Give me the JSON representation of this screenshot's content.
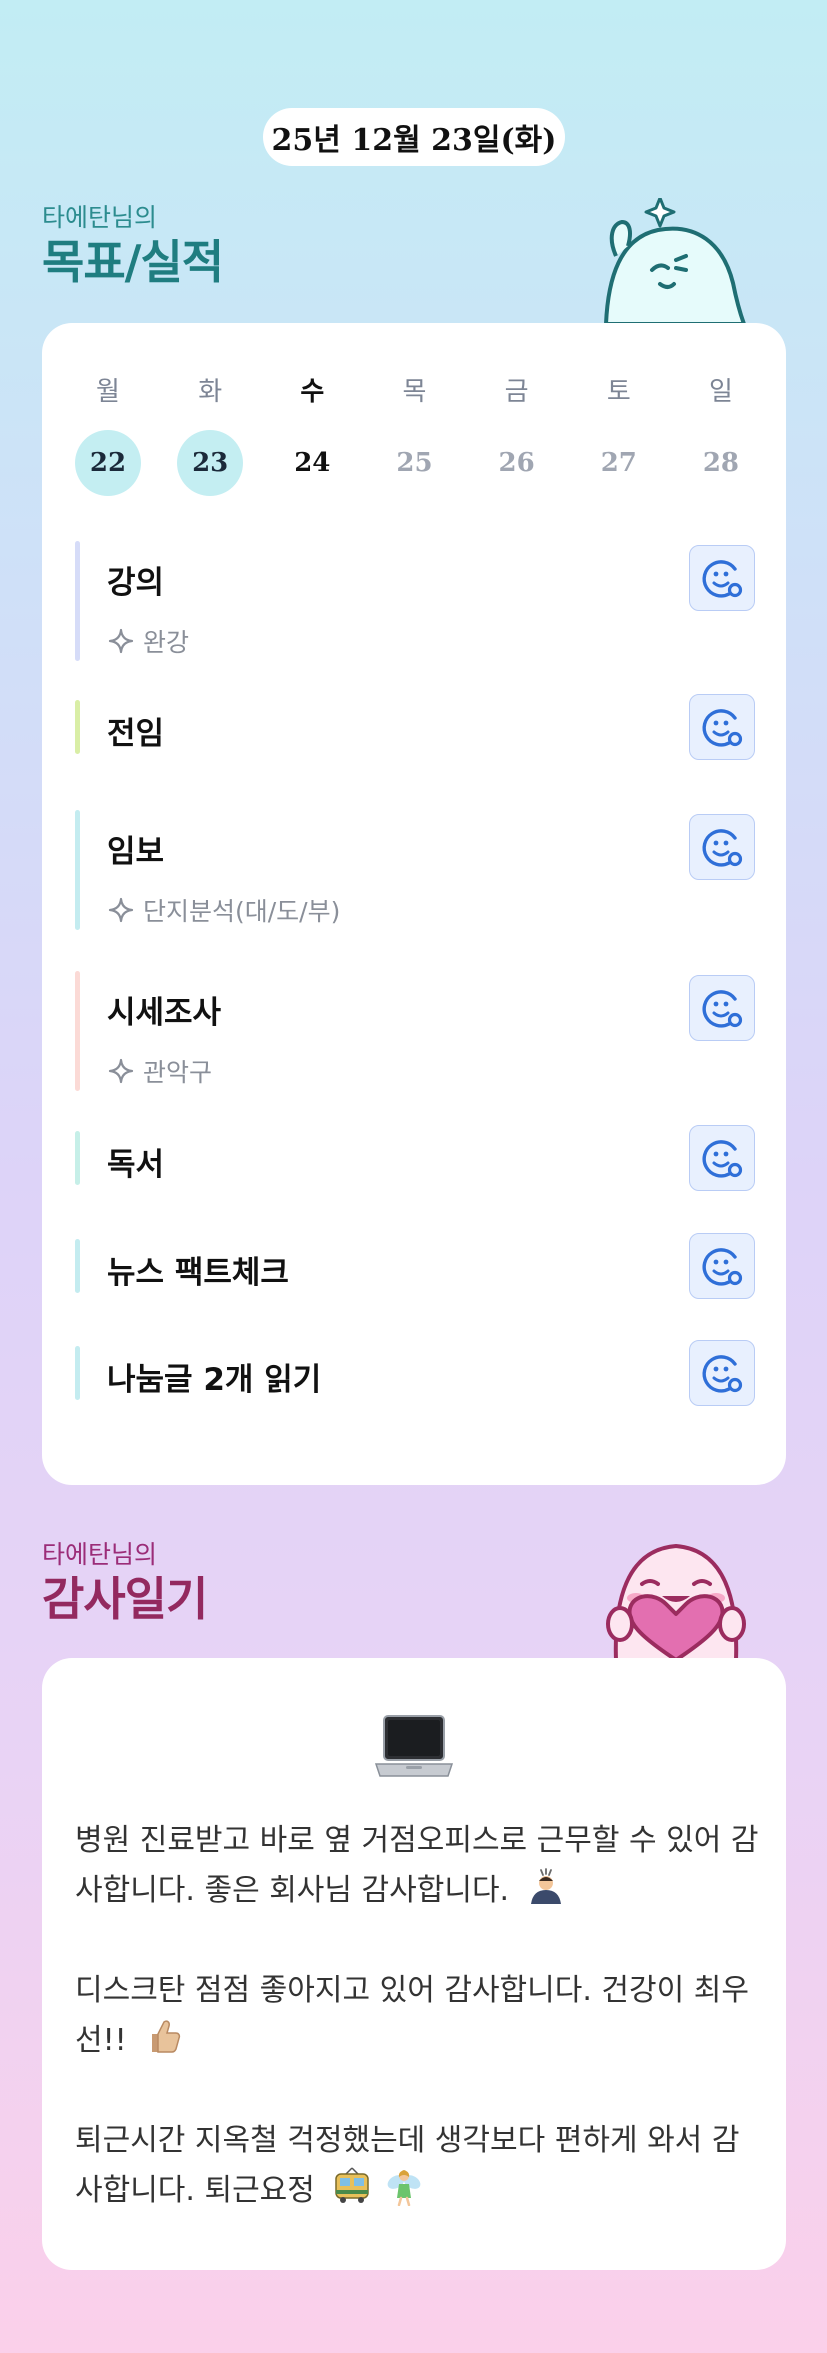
{
  "header": {
    "date": "25년 12월 23일(화)"
  },
  "goals_section": {
    "owner": "타에탄님의",
    "title": "목표/실적",
    "weekdays": [
      "월",
      "화",
      "수",
      "목",
      "금",
      "토",
      "일"
    ],
    "dates": [
      "22",
      "23",
      "24",
      "25",
      "26",
      "27",
      "28"
    ],
    "goals": [
      {
        "title": "강의",
        "sub": "완강",
        "bar_color": "#d6dcf8"
      },
      {
        "title": "전임",
        "sub": "",
        "bar_color": "#d9eea6"
      },
      {
        "title": "임보",
        "sub": "단지분석(대/도/부)",
        "bar_color": "#c4ecf0"
      },
      {
        "title": "시세조사",
        "sub": "관악구",
        "bar_color": "#fbdad6"
      },
      {
        "title": "독서",
        "sub": "",
        "bar_color": "#c6efe8"
      },
      {
        "title": "뉴스 팩트체크",
        "sub": "",
        "bar_color": "#c4ecf0"
      },
      {
        "title": "나눔글 2개 읽기",
        "sub": "",
        "bar_color": "#c4ecf0"
      }
    ]
  },
  "thanks_section": {
    "owner": "타에탄님의",
    "title": "감사일기",
    "entries": [
      "병원 진료받고 바로 옆 거점오피스로 근무할 수 있어 감사합니다. 좋은 회사님 감사합니다.",
      "디스크탄 점점 좋아지고 있어 감사합니다. 건강이 최우선!!",
      "퇴근시간 지옥철 걱정했는데 생각보다 편하게 와서 감사합니다. 퇴근요정"
    ]
  },
  "icons": {
    "goal_action": "smiley-status-icon",
    "goal_sub": "sparkle-icon",
    "thanks_header": "laptop-emoji",
    "entry_emojis": [
      "bowing-person-emoji",
      "thumbs-up-emoji",
      "tram-fairy-emoji"
    ]
  },
  "colors": {
    "accent_teal": "#1f7d80",
    "accent_plum": "#93295f",
    "done_date_bg": "#c4eef2",
    "action_blue": "#2f6fd8"
  }
}
